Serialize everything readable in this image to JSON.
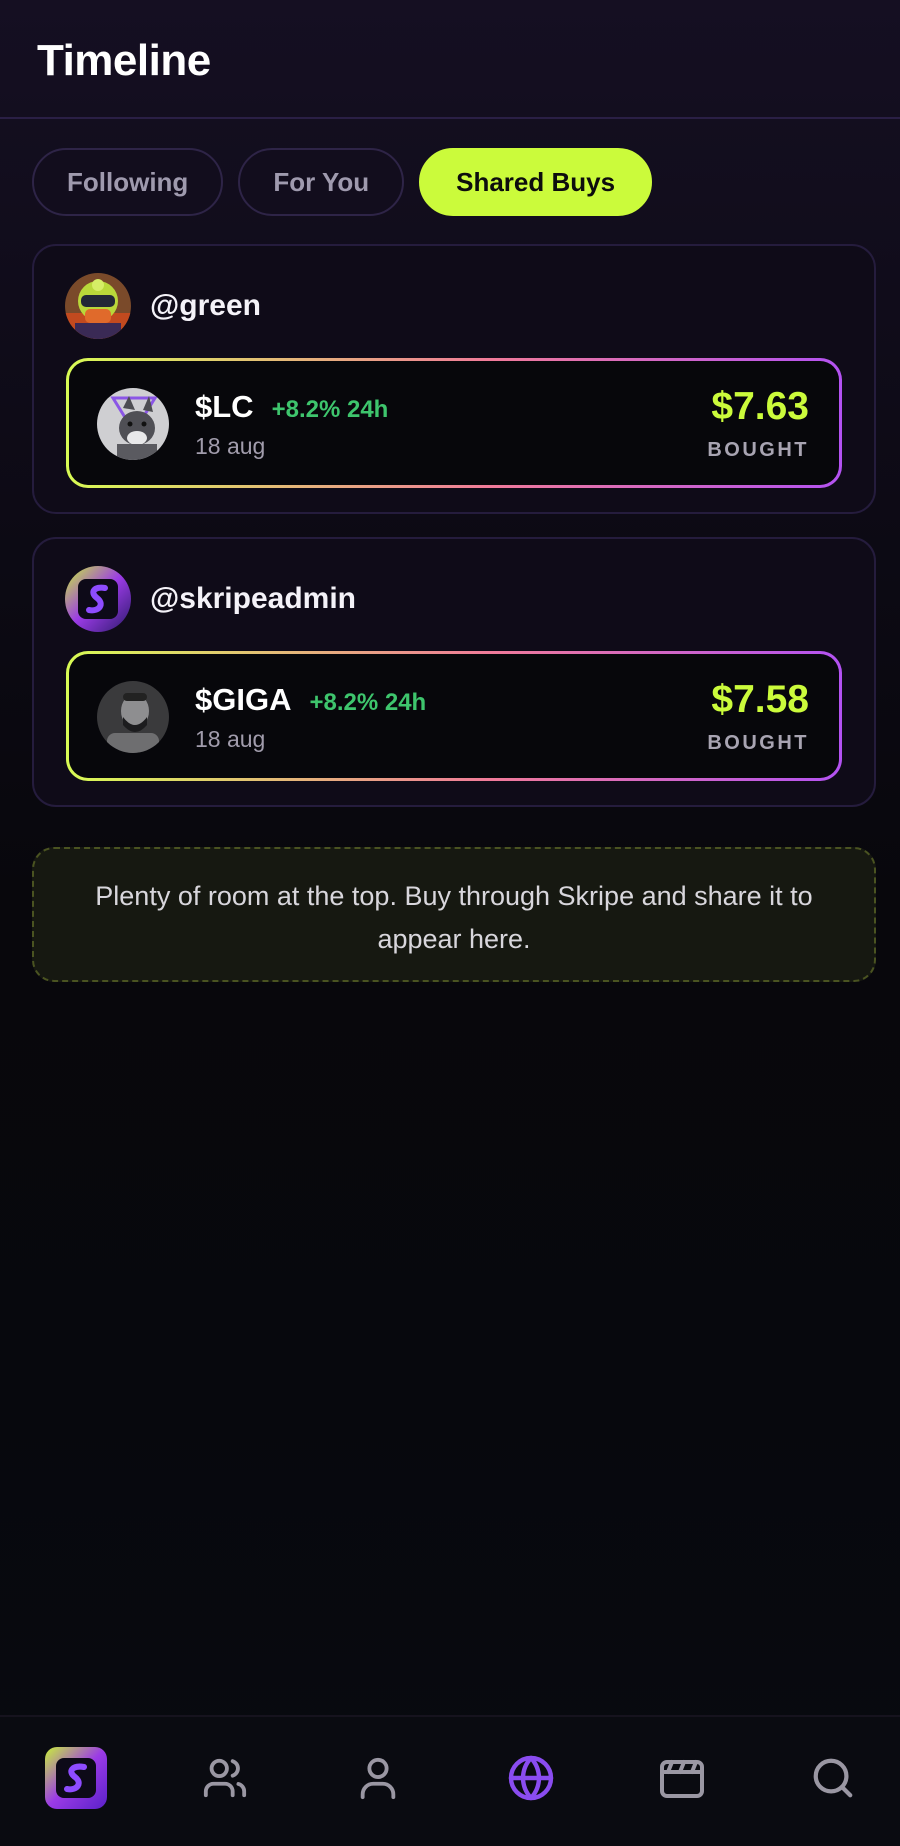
{
  "header": {
    "title": "Timeline"
  },
  "tabs": [
    {
      "label": "Following",
      "active": false
    },
    {
      "label": "For You",
      "active": false
    },
    {
      "label": "Shared Buys",
      "active": true
    }
  ],
  "posts": [
    {
      "username": "@green",
      "avatar_icon": "helmet-avatar",
      "trade": {
        "token_icon": "wolf-token-icon",
        "symbol": "$LC",
        "change": "+8.2% 24h",
        "date": "18 aug",
        "amount": "$7.63",
        "action": "BOUGHT"
      }
    },
    {
      "username": "@skripeadmin",
      "avatar_icon": "skripe-logo-avatar",
      "trade": {
        "token_icon": "giga-chad-token-icon",
        "symbol": "$GIGA",
        "change": "+8.2% 24h",
        "date": "18 aug",
        "amount": "$7.58",
        "action": "BOUGHT"
      }
    }
  ],
  "empty_state": {
    "text": "Plenty of room at the top. Buy through Skripe and share it to appear here."
  },
  "bottom_nav": [
    {
      "name": "home",
      "icon": "skripe-logo-icon",
      "active": false
    },
    {
      "name": "friends",
      "icon": "users-icon",
      "active": false
    },
    {
      "name": "profile",
      "icon": "user-icon",
      "active": false
    },
    {
      "name": "timeline",
      "icon": "globe-icon",
      "active": true
    },
    {
      "name": "feed",
      "icon": "clapperboard-icon",
      "active": false
    },
    {
      "name": "search",
      "icon": "search-icon",
      "active": false
    }
  ],
  "colors": {
    "accent": "#cbfb3b",
    "positive": "#3ec56d",
    "active_nav": "#8a4cf0",
    "inactive_nav": "#9a97a3"
  }
}
